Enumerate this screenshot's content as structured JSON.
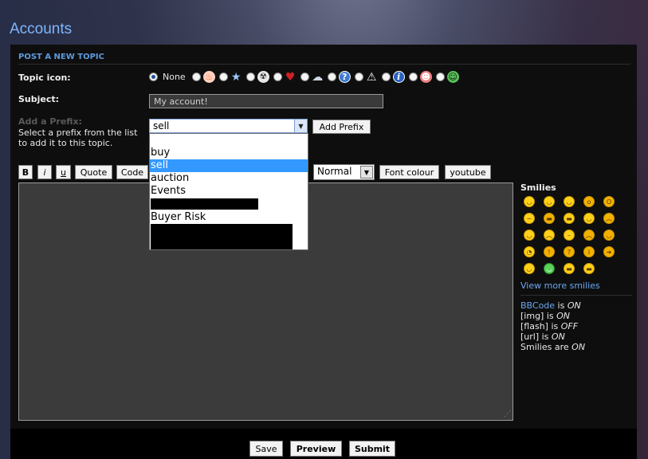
{
  "page": {
    "title": "Accounts"
  },
  "panel": {
    "header": "POST A NEW TOPIC"
  },
  "topic_icon": {
    "label": "Topic icon:",
    "none_label": "None",
    "icons": [
      "flame-icon",
      "star-icon",
      "radioactive-icon",
      "heart-icon",
      "thought-bubble-icon",
      "question-icon",
      "warning-icon",
      "info-icon",
      "face-icon",
      "grin-icon"
    ]
  },
  "subject": {
    "label": "Subject:",
    "value": "My account!"
  },
  "prefix": {
    "ghost_label": "Add a Prefix:",
    "help": "Select a prefix from the list to add it to this topic.",
    "selected": "sell",
    "add_button": "Add Prefix",
    "options": [
      "",
      "buy",
      "sell",
      "auction",
      "Events",
      "[redacted]",
      "Buyer Risk",
      "[redacted]"
    ]
  },
  "toolbar": {
    "bold": "B",
    "italic": "i",
    "underline": "u",
    "quote": "Quote",
    "code": "Code",
    "size": "Normal",
    "font_colour": "Font colour",
    "youtube": "youtube"
  },
  "smilies": {
    "title": "Smilies",
    "view_more": "View more smilies"
  },
  "status": {
    "bbcode_link": "BBCode",
    "bbcode_text": " is ",
    "bbcode_state": "ON",
    "img_text": "[img] is ",
    "img_state": "ON",
    "flash_text": "[flash] is ",
    "flash_state": "OFF",
    "url_text": "[url] is ",
    "url_state": "ON",
    "smilies_text": "Smilies are ",
    "smilies_state": "ON"
  },
  "footer": {
    "save": "Save",
    "preview": "Preview",
    "submit": "Submit"
  }
}
